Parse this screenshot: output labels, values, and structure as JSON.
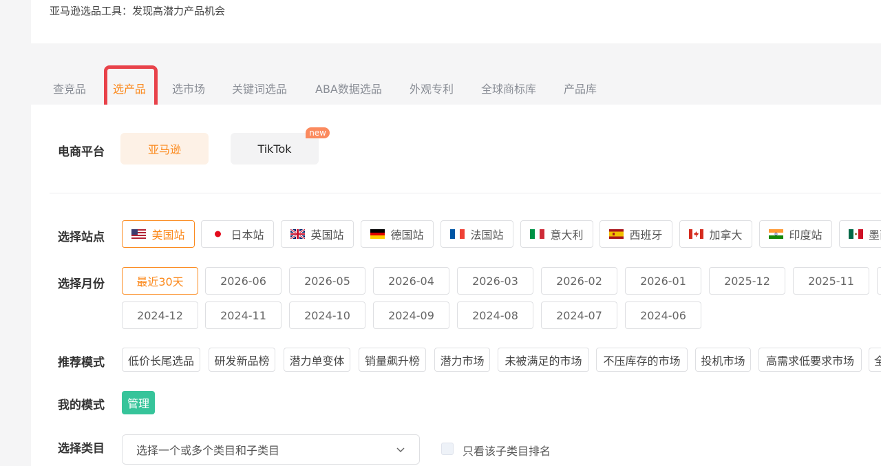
{
  "header": {
    "title": "亚马逊选品工具：发现高潜力产品机会"
  },
  "tabs": [
    {
      "label": "查竞品"
    },
    {
      "label": "选产品",
      "active": true
    },
    {
      "label": "选市场"
    },
    {
      "label": "关键词选品"
    },
    {
      "label": "ABA数据选品"
    },
    {
      "label": "外观专利"
    },
    {
      "label": "全球商标库"
    },
    {
      "label": "产品库"
    }
  ],
  "platform": {
    "label": "电商平台",
    "options": [
      {
        "label": "亚马逊",
        "selected": true
      },
      {
        "label": "TikTok",
        "badge": "new"
      }
    ]
  },
  "sites": {
    "label": "选择站点",
    "items": [
      {
        "label": "美国站",
        "flag": "us-flag-icon",
        "selected": true
      },
      {
        "label": "日本站",
        "flag": "jp-flag-icon"
      },
      {
        "label": "英国站",
        "flag": "uk-flag-icon"
      },
      {
        "label": "德国站",
        "flag": "de-flag-icon"
      },
      {
        "label": "法国站",
        "flag": "fr-flag-icon"
      },
      {
        "label": "意大利",
        "flag": "it-flag-icon"
      },
      {
        "label": "西班牙",
        "flag": "es-flag-icon"
      },
      {
        "label": "加拿大",
        "flag": "ca-flag-icon"
      },
      {
        "label": "印度站",
        "flag": "in-flag-icon"
      },
      {
        "label": "墨西",
        "flag": "mx-flag-icon"
      }
    ]
  },
  "months": {
    "label": "选择月份",
    "row1": [
      "最近30天",
      "2026-06",
      "2026-05",
      "2026-04",
      "2026-03",
      "2026-02",
      "2026-01",
      "2025-12",
      "2025-11"
    ],
    "row2": [
      "2024-12",
      "2024-11",
      "2024-10",
      "2024-09",
      "2024-08",
      "2024-07",
      "2024-06"
    ],
    "selected": "最近30天"
  },
  "recommend": {
    "label": "推荐模式",
    "items": [
      "低价长尾选品",
      "研发新品榜",
      "潜力单变体",
      "销量飙升榜",
      "潜力市场",
      "未被满足的市场",
      "不压库存的市场",
      "投机市场",
      "高需求低要求市场",
      "全"
    ]
  },
  "my_mode": {
    "label": "我的模式",
    "manage": "管理"
  },
  "category": {
    "label": "选择类目",
    "placeholder": "选择一个或多个类目和子类目",
    "checkbox_label": "只看该子类目排名"
  },
  "colors": {
    "accent": "#fb8a1e",
    "highlight": "#e8424a",
    "manage": "#36c49a"
  }
}
